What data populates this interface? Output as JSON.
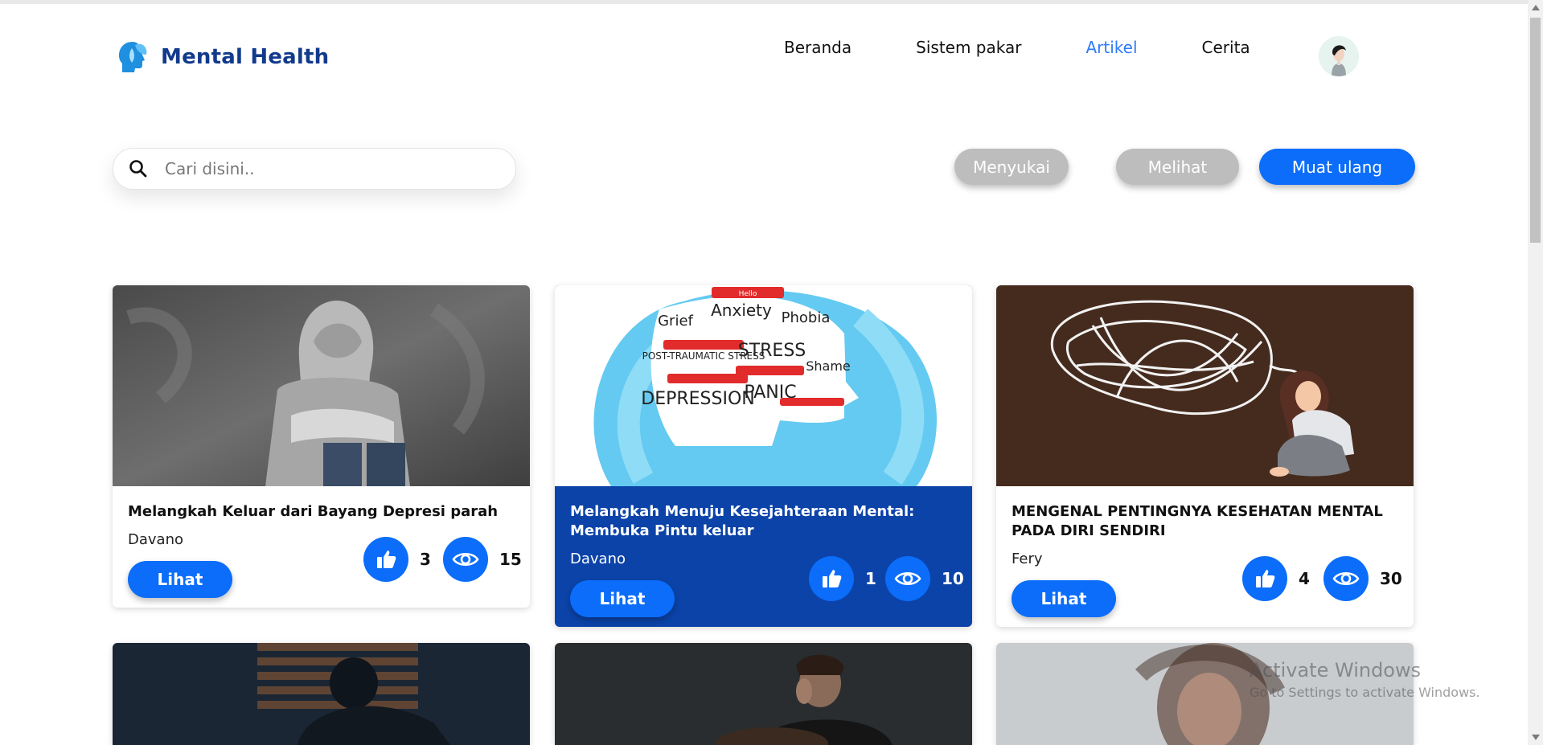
{
  "brand": {
    "name": "Mental Health"
  },
  "nav": {
    "items": [
      {
        "label": "Beranda"
      },
      {
        "label": "Sistem pakar"
      },
      {
        "label": "Artikel",
        "active": true
      },
      {
        "label": "Cerita"
      }
    ]
  },
  "search": {
    "placeholder": "Cari disini.."
  },
  "filters": {
    "liked_label": "Menyukai",
    "viewed_label": "Melihat",
    "reload_label": "Muat ulang"
  },
  "colors": {
    "primary": "#0b6dfa",
    "brand_text": "#123a8c",
    "active_nav": "#2e7bf6",
    "highlight_card": "#0b43a8",
    "inactive_filter": "#bdbdbd"
  },
  "articles": [
    {
      "title": "Melangkah Keluar dari Bayang Depresi parah",
      "author": "Davano",
      "likes": "3",
      "views": "15",
      "button": "Lihat"
    },
    {
      "title": "Melangkah Menuju Kesejahteraan Mental: Membuka Pintu keluar",
      "author": "Davano",
      "likes": "1",
      "views": "10",
      "button": "Lihat",
      "highlighted": true
    },
    {
      "title": "MENGENAL PENTINGNYA KESEHATAN MENTAL PADA DIRI SENDIRI",
      "author": "Fery",
      "likes": "4",
      "views": "30",
      "button": "Lihat"
    }
  ],
  "image_texts": [
    "Hello",
    "Anxiety",
    "Phobia",
    "Grief",
    "POST-TRAUMATIC STRESS",
    "STRESS",
    "Shame",
    "DEPRESSION",
    "PANIC"
  ],
  "watermark": {
    "line1": "Activate Windows",
    "line2": "Go to Settings to activate Windows."
  }
}
